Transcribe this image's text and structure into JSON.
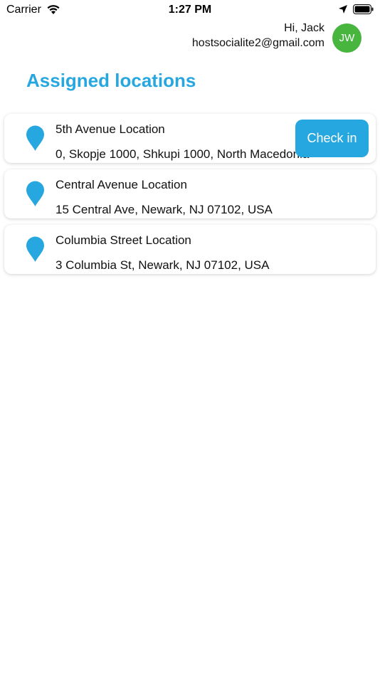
{
  "status_bar": {
    "carrier": "Carrier",
    "time": "1:27 PM",
    "icons": [
      "wifi-icon",
      "location-arrow-icon",
      "battery-icon"
    ]
  },
  "header": {
    "greeting": "Hi, Jack",
    "email": "hostsocialite2@gmail.com",
    "avatar_initials": "JW",
    "avatar_color": "#47b53e"
  },
  "page": {
    "title": "Assigned locations"
  },
  "locations": [
    {
      "name": "5th Avenue Location",
      "address": "0, Skopje 1000, Shkupi 1000, North Macedonia",
      "action_label": "Check in"
    },
    {
      "name": "Central Avenue Location",
      "address": "15 Central Ave, Newark, NJ 07102, USA"
    },
    {
      "name": "Columbia Street Location",
      "address": "3 Columbia St, Newark, NJ 07102, USA"
    }
  ],
  "colors": {
    "accent": "#27a7df",
    "avatar": "#47b53e",
    "background": "#ffffff"
  }
}
